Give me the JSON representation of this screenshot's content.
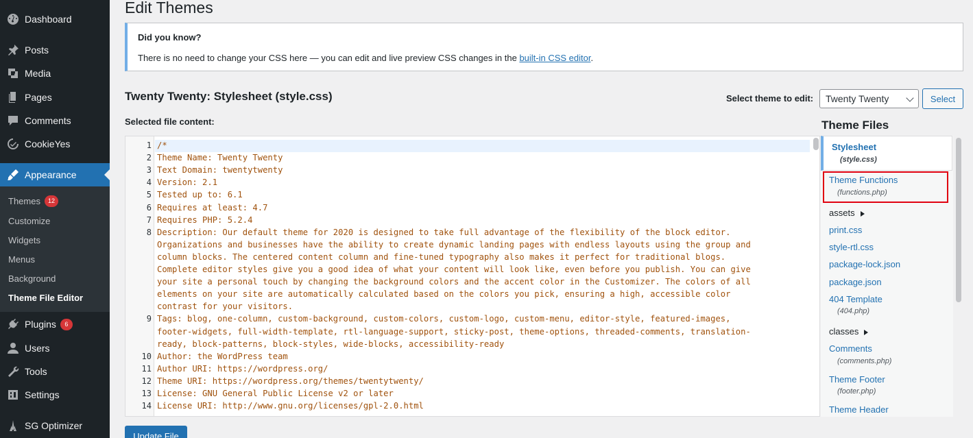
{
  "sidebar": {
    "menu": [
      {
        "label": "Dashboard",
        "icon": "dashboard-icon"
      },
      {
        "label": "Posts",
        "icon": "pin-icon"
      },
      {
        "label": "Media",
        "icon": "media-icon"
      },
      {
        "label": "Pages",
        "icon": "pages-icon"
      },
      {
        "label": "Comments",
        "icon": "comment-icon"
      },
      {
        "label": "CookieYes",
        "icon": "cookieyes-icon"
      },
      {
        "label": "Appearance",
        "icon": "brush-icon"
      },
      {
        "label": "Plugins",
        "icon": "plugin-icon",
        "badge": "6"
      },
      {
        "label": "Users",
        "icon": "user-icon"
      },
      {
        "label": "Tools",
        "icon": "wrench-icon"
      },
      {
        "label": "Settings",
        "icon": "settings-icon"
      },
      {
        "label": "SG Optimizer",
        "icon": "sg-optimizer-icon"
      }
    ],
    "submenu": [
      {
        "label": "Themes",
        "badge": "12"
      },
      {
        "label": "Customize"
      },
      {
        "label": "Widgets"
      },
      {
        "label": "Menus"
      },
      {
        "label": "Background"
      },
      {
        "label": "Theme File Editor"
      }
    ]
  },
  "main": {
    "title": "Edit Themes",
    "notice": {
      "title": "Did you know?",
      "text_before": "There is no need to change your CSS here — you can edit and live preview CSS changes in the ",
      "link": "built-in CSS editor",
      "text_after": "."
    },
    "file_heading": "Twenty Twenty: Stylesheet (style.css)",
    "select_label": "Select theme to edit:",
    "selected_theme": "Twenty Twenty",
    "select_button": "Select",
    "content_label": "Selected file content:",
    "update_button": "Update File"
  },
  "editor": {
    "lines": [
      {
        "n": "1",
        "text": "/*"
      },
      {
        "n": "2",
        "text": "Theme Name: Twenty Twenty"
      },
      {
        "n": "3",
        "text": "Text Domain: twentytwenty"
      },
      {
        "n": "4",
        "text": "Version: 2.1"
      },
      {
        "n": "5",
        "text": "Tested up to: 6.1"
      },
      {
        "n": "6",
        "text": "Requires at least: 4.7"
      },
      {
        "n": "7",
        "text": "Requires PHP: 5.2.4"
      },
      {
        "n": "8",
        "text": "Description: Our default theme for 2020 is designed to take full advantage of the flexibility of the block editor."
      },
      {
        "n": "",
        "text": "Organizations and businesses have the ability to create dynamic landing pages with endless layouts using the group and"
      },
      {
        "n": "",
        "text": "column blocks. The centered content column and fine-tuned typography also makes it perfect for traditional blogs."
      },
      {
        "n": "",
        "text": "Complete editor styles give you a good idea of what your content will look like, even before you publish. You can give"
      },
      {
        "n": "",
        "text": "your site a personal touch by changing the background colors and the accent color in the Customizer. The colors of all"
      },
      {
        "n": "",
        "text": "elements on your site are automatically calculated based on the colors you pick, ensuring a high, accessible color"
      },
      {
        "n": "",
        "text": "contrast for your visitors."
      },
      {
        "n": "9",
        "text": "Tags: blog, one-column, custom-background, custom-colors, custom-logo, custom-menu, editor-style, featured-images,"
      },
      {
        "n": "",
        "text": "footer-widgets, full-width-template, rtl-language-support, sticky-post, theme-options, threaded-comments, translation-"
      },
      {
        "n": "",
        "text": "ready, block-patterns, block-styles, wide-blocks, accessibility-ready"
      },
      {
        "n": "10",
        "text": "Author: the WordPress team"
      },
      {
        "n": "11",
        "text": "Author URI: https://wordpress.org/"
      },
      {
        "n": "12",
        "text": "Theme URI: https://wordpress.org/themes/twentytwenty/"
      },
      {
        "n": "13",
        "text": "License: GNU General Public License v2 or later"
      },
      {
        "n": "14",
        "text": "License URI: http://www.gnu.org/licenses/gpl-2.0.html"
      }
    ]
  },
  "theme_files": {
    "title": "Theme Files",
    "current": {
      "name": "Stylesheet",
      "file": "(style.css)"
    },
    "items": [
      {
        "name": "Theme Functions",
        "file": "(functions.php)"
      },
      {
        "folder": "assets"
      },
      {
        "name": "print.css"
      },
      {
        "name": "style-rtl.css"
      },
      {
        "name": "package-lock.json"
      },
      {
        "name": "package.json"
      },
      {
        "name": "404 Template",
        "file": "(404.php)"
      },
      {
        "folder": "classes"
      },
      {
        "name": "Comments",
        "file": "(comments.php)"
      },
      {
        "name": "Theme Footer",
        "file": "(footer.php)"
      },
      {
        "name": "Theme Header"
      }
    ]
  },
  "colors": {
    "sidebar_bg": "#1d2327",
    "accent": "#2271b1",
    "code": "#a0520d",
    "highlight_box": "#e0000f"
  }
}
